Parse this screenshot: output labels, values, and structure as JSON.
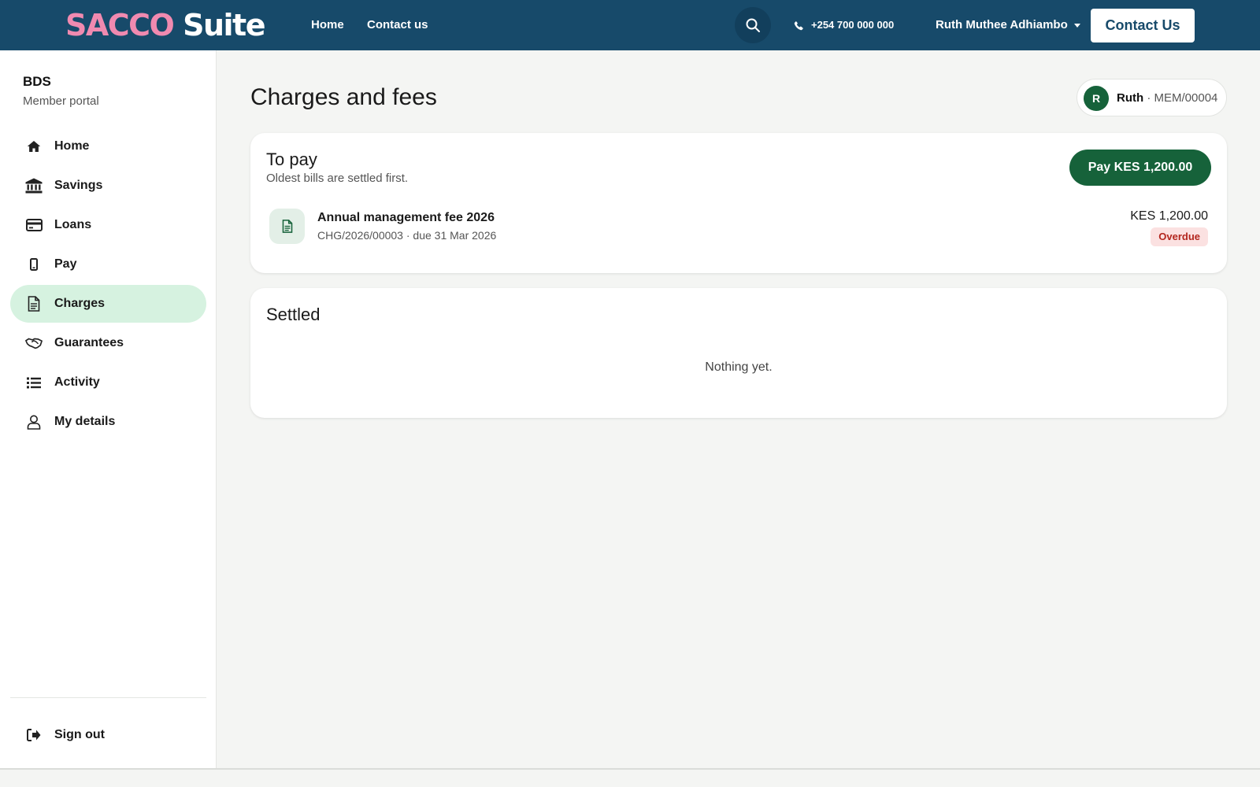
{
  "header": {
    "brand_part1": "SACCO",
    "brand_part2": "Suite",
    "nav": [
      "Home",
      "Contact us"
    ],
    "phone": "+254 700 000 000",
    "user_name": "Ruth Muthee Adhiambo",
    "contact_button": "Contact Us"
  },
  "sidebar": {
    "org_name": "BDS",
    "org_subtitle": "Member portal",
    "items": [
      {
        "label": "Home",
        "icon": "home-icon"
      },
      {
        "label": "Savings",
        "icon": "bank-icon"
      },
      {
        "label": "Loans",
        "icon": "credit-card-icon"
      },
      {
        "label": "Pay",
        "icon": "mobile-phone-icon"
      },
      {
        "label": "Charges",
        "icon": "document-icon",
        "active": true
      },
      {
        "label": "Guarantees",
        "icon": "handshake-icon"
      },
      {
        "label": "Activity",
        "icon": "list-icon"
      },
      {
        "label": "My details",
        "icon": "user-icon"
      }
    ],
    "sign_out": "Sign out"
  },
  "page": {
    "title": "Charges and fees",
    "member_chip": {
      "initial": "R",
      "name": "Ruth",
      "separator": " · ",
      "member_no": "MEM/00004"
    }
  },
  "to_pay": {
    "title": "To pay",
    "subtitle": "Oldest bills are settled first.",
    "pay_button": "Pay KES 1,200.00",
    "bills": [
      {
        "title": "Annual management fee 2026",
        "meta": "CHG/2026/00003 · due 31 Mar 2026",
        "amount": "KES 1,200.00",
        "status": "Overdue"
      }
    ]
  },
  "settled": {
    "title": "Settled",
    "empty_text": "Nothing yet."
  },
  "colors": {
    "header_bg": "#174a6a",
    "brand_pink": "#f08ab0",
    "primary_green": "#16623a",
    "active_nav_bg": "#d6f2e0",
    "overdue_bg": "#fbe1e1",
    "overdue_text": "#b3261e",
    "page_bg": "#f4f5f3"
  }
}
